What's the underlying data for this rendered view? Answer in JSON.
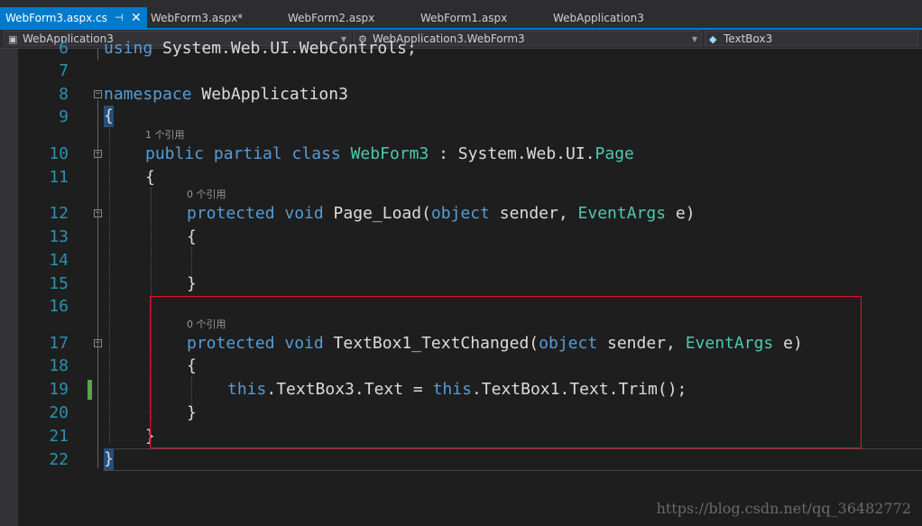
{
  "tabs": [
    {
      "label": "WebForm3.aspx.cs",
      "pin": "⊣",
      "close": "✕",
      "active": true
    },
    {
      "label": "WebForm3.aspx*"
    },
    {
      "label": "WebForm2.aspx"
    },
    {
      "label": "WebForm1.aspx"
    },
    {
      "label": "WebApplication3"
    }
  ],
  "nav": {
    "project": "WebApplication3",
    "class": "WebApplication3.WebForm3",
    "member": "TextBox3"
  },
  "icons": {
    "project": "project-icon",
    "class": "class-icon",
    "member": "field-icon"
  },
  "lines": {
    "n6": "6",
    "n7": "7",
    "n8": "8",
    "n9": "9",
    "n10": "10",
    "n11": "11",
    "n12": "12",
    "n13": "13",
    "n14": "14",
    "n15": "15",
    "n16": "16",
    "n17": "17",
    "n18": "18",
    "n19": "19",
    "n20": "20",
    "n21": "21",
    "n22": "22"
  },
  "code": {
    "l6_kw": "using",
    "l6_rest": " System.Web.UI.WebControls;",
    "l8_kw": "namespace",
    "l8_rest": " WebApplication3",
    "l9": "{",
    "lens10": "1 个引用",
    "l10_kw": "public partial class",
    "l10_type": "WebForm3",
    "l10_mid": " : System.Web.UI.",
    "l10_type2": "Page",
    "l11": "{",
    "lens12": "0 个引用",
    "l12_kw": "protected void",
    "l12_name": " Page_Load(",
    "l12_kw2": "object",
    "l12_mid": " sender, ",
    "l12_type": "EventArgs",
    "l12_end": " e)",
    "l13": "{",
    "l15": "}",
    "lens17": "0 个引用",
    "l17_kw": "protected void",
    "l17_name": " TextBox1_TextChanged(",
    "l17_kw2": "object",
    "l17_mid": " sender, ",
    "l17_type": "EventArgs",
    "l17_end": " e)",
    "l18": "{",
    "l19_kw": "this",
    "l19_mid": ".TextBox3.Text = ",
    "l19_kw2": "this",
    "l19_end": ".TextBox1.Text.Trim();",
    "l20": "}",
    "l21": "}",
    "l22": "}"
  },
  "watermark": "https://blog.csdn.net/qq_36482772",
  "colors": {
    "accent": "#007acc",
    "keyword": "#569cd6",
    "type": "#4ec9b0",
    "line_number": "#2b91af",
    "highlight_box": "#e81123",
    "change_marker": "#57a64a"
  }
}
